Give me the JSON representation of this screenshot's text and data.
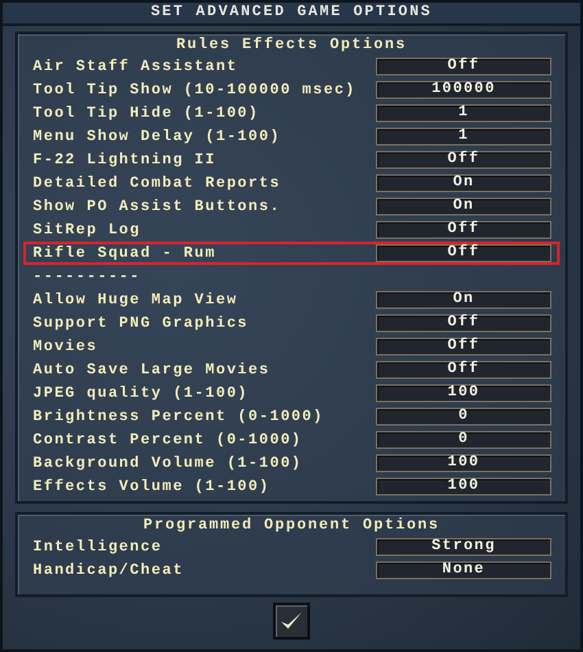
{
  "window": {
    "title": "SET ADVANCED GAME OPTIONS"
  },
  "sections": [
    {
      "title": "Rules Effects Options",
      "rows": [
        {
          "kind": "option",
          "label": "Air Staff Assistant",
          "value": "Off",
          "selected": false
        },
        {
          "kind": "option",
          "label": "Tool Tip Show (10-100000 msec)",
          "value": "100000",
          "selected": false
        },
        {
          "kind": "option",
          "label": "Tool Tip Hide (1-100)",
          "value": "1",
          "selected": false
        },
        {
          "kind": "option",
          "label": "Menu Show Delay (1-100)",
          "value": "1",
          "selected": false
        },
        {
          "kind": "option",
          "label": "F-22 Lightning II",
          "value": "Off",
          "selected": false
        },
        {
          "kind": "option",
          "label": "Detailed Combat Reports",
          "value": "On",
          "selected": false
        },
        {
          "kind": "option",
          "label": "Show PO Assist Buttons.",
          "value": "On",
          "selected": false
        },
        {
          "kind": "option",
          "label": "SitRep Log",
          "value": "Off",
          "selected": false
        },
        {
          "kind": "option",
          "label": "Rifle Squad - Rum",
          "value": "Off",
          "selected": true
        },
        {
          "kind": "separator",
          "label": "----------"
        },
        {
          "kind": "option",
          "label": "Allow Huge Map View",
          "value": "On",
          "selected": false
        },
        {
          "kind": "option",
          "label": "Support PNG Graphics",
          "value": "Off",
          "selected": false
        },
        {
          "kind": "option",
          "label": "Movies",
          "value": "Off",
          "selected": false
        },
        {
          "kind": "option",
          "label": "Auto Save Large Movies",
          "value": "Off",
          "selected": false
        },
        {
          "kind": "option",
          "label": "JPEG quality (1-100)",
          "value": "100",
          "selected": false
        },
        {
          "kind": "option",
          "label": "Brightness Percent (0-1000)",
          "value": "0",
          "selected": false
        },
        {
          "kind": "option",
          "label": "Contrast Percent (0-1000)",
          "value": "0",
          "selected": false
        },
        {
          "kind": "option",
          "label": "Background Volume (1-100)",
          "value": "100",
          "selected": false
        },
        {
          "kind": "option",
          "label": "Effects Volume (1-100)",
          "value": "100",
          "selected": false
        }
      ]
    },
    {
      "title": "Programmed Opponent Options",
      "rows": [
        {
          "kind": "option",
          "label": "Intelligence",
          "value": "Strong",
          "selected": false
        },
        {
          "kind": "option",
          "label": "Handicap/Cheat",
          "value": "None",
          "selected": false
        }
      ]
    }
  ],
  "confirm_button": {
    "kind": "check"
  }
}
